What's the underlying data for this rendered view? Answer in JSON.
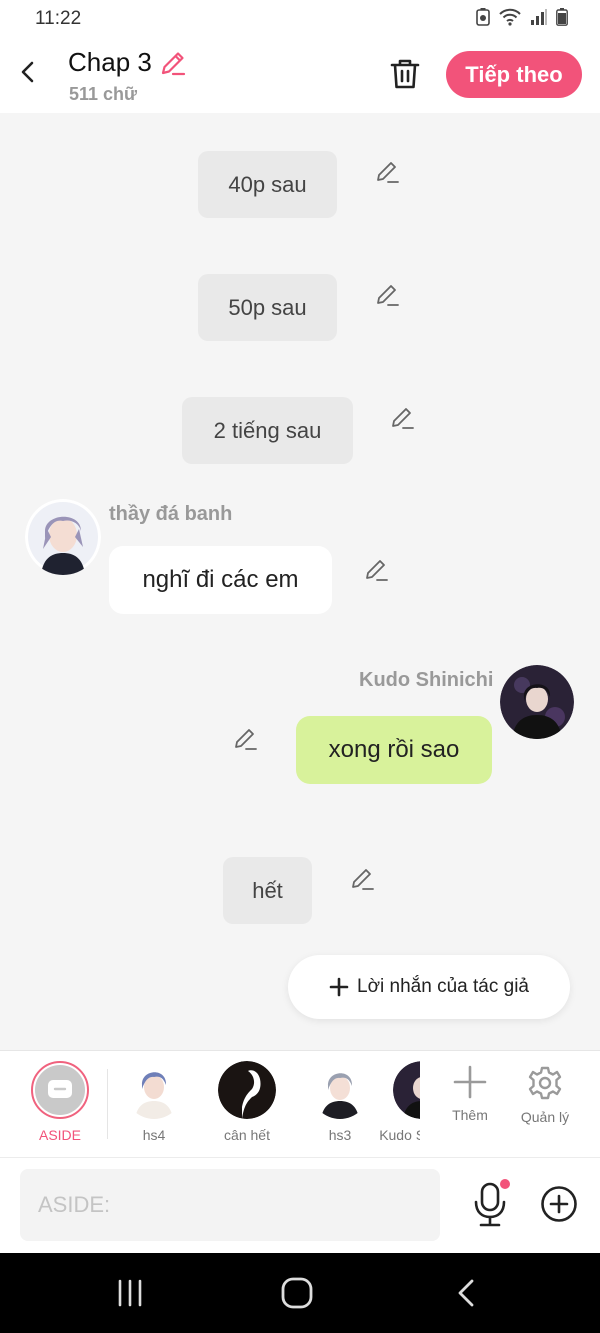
{
  "status_bar": {
    "time": "11:22"
  },
  "header": {
    "title": "Chap 3",
    "word_count": "511 chữ",
    "next_label": "Tiếp theo",
    "accent_color": "#f2537a"
  },
  "messages": {
    "m1": "40p sau",
    "m2": "50p sau",
    "m3": "2 tiếng sau",
    "m4_speaker": "thầy đá banh",
    "m4_text": "nghĩ đi các em",
    "m5_speaker": "Kudo Shinichi",
    "m5_text": "xong rồi sao",
    "m6": "hết"
  },
  "author_note_label": "Lời nhắn của tác giả",
  "characters": [
    {
      "label": "ASIDE",
      "icon": "message-icon"
    },
    {
      "label": "hs4"
    },
    {
      "label": "cân hết"
    },
    {
      "label": "hs3"
    },
    {
      "label": "Kudo Shinichi"
    }
  ],
  "actions": {
    "add_label": "Thêm",
    "manage_label": "Quản lý"
  },
  "input": {
    "placeholder": "ASIDE:"
  }
}
